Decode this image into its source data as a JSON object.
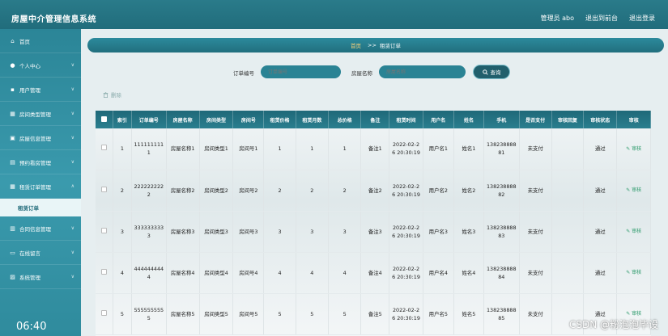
{
  "header": {
    "title": "房屋中介管理信息系统",
    "user": "管理员 abo",
    "back_label": "退出到前台",
    "logout_label": "退出登录"
  },
  "sidebar": {
    "items": [
      {
        "label": "首页",
        "icon": "home-icon"
      },
      {
        "label": "个人中心",
        "icon": "user-icon"
      },
      {
        "label": "用户管理",
        "icon": "users-icon"
      },
      {
        "label": "房间类型管理",
        "icon": "grid-icon"
      },
      {
        "label": "房屋信息管理",
        "icon": "house-icon"
      },
      {
        "label": "预约看房管理",
        "icon": "calendar-icon"
      },
      {
        "label": "租赁订单管理",
        "icon": "grid-icon"
      },
      {
        "label": "租赁订单",
        "icon": "",
        "sub": true
      },
      {
        "label": "合同信息管理",
        "icon": "contract-icon"
      },
      {
        "label": "在线留言",
        "icon": "message-icon"
      },
      {
        "label": "系统管理",
        "icon": "settings-icon"
      }
    ]
  },
  "breadcrumb": {
    "home": "首页",
    "sep": ">>",
    "current": "租赁订单"
  },
  "search": {
    "order_label": "订单编号",
    "order_placeholder": "订单编号",
    "house_label": "房屋名称",
    "house_placeholder": "房屋名称",
    "button_label": "查询"
  },
  "toolbar": {
    "delete_label": "删除"
  },
  "table": {
    "headers": [
      "索引",
      "订单编号",
      "房屋名称",
      "房间类型",
      "房间号",
      "租赁价格",
      "租赁月数",
      "总价格",
      "备注",
      "租赁时间",
      "用户名",
      "姓名",
      "手机",
      "是否支付",
      "审核回复",
      "审核状态",
      "审核"
    ],
    "rows": [
      [
        "1",
        "1111111111",
        "房屋名称1",
        "房间类型1",
        "房间号1",
        "1",
        "1",
        "1",
        "备注1",
        "2022-02-26 20:30:19",
        "用户名1",
        "姓名1",
        "13823888881",
        "未支付",
        "",
        "通过",
        "审核"
      ],
      [
        "2",
        "2222222222",
        "房屋名称2",
        "房间类型2",
        "房间号2",
        "2",
        "2",
        "2",
        "备注2",
        "2022-02-26 20:30:19",
        "用户名2",
        "姓名2",
        "13823888882",
        "未支付",
        "",
        "通过",
        "审核"
      ],
      [
        "3",
        "3333333333",
        "房屋名称3",
        "房间类型3",
        "房间号3",
        "3",
        "3",
        "3",
        "备注3",
        "2022-02-26 20:30:19",
        "用户名3",
        "姓名3",
        "13823888883",
        "未支付",
        "",
        "通过",
        "审核"
      ],
      [
        "4",
        "4444444444",
        "房屋名称4",
        "房间类型4",
        "房间号4",
        "4",
        "4",
        "4",
        "备注4",
        "2022-02-26 20:30:19",
        "用户名4",
        "姓名4",
        "13823888884",
        "未支付",
        "",
        "通过",
        "审核"
      ],
      [
        "5",
        "5555555555",
        "房屋名称5",
        "房间类型5",
        "房间号5",
        "5",
        "5",
        "5",
        "备注5",
        "2022-02-26 20:30:19",
        "用户名5",
        "姓名5",
        "13823888885",
        "未支付",
        "",
        "通过",
        "审核"
      ]
    ]
  },
  "overlay": {
    "clock": "06:40",
    "watermark": "CSDN @粉泡泡毕设"
  }
}
